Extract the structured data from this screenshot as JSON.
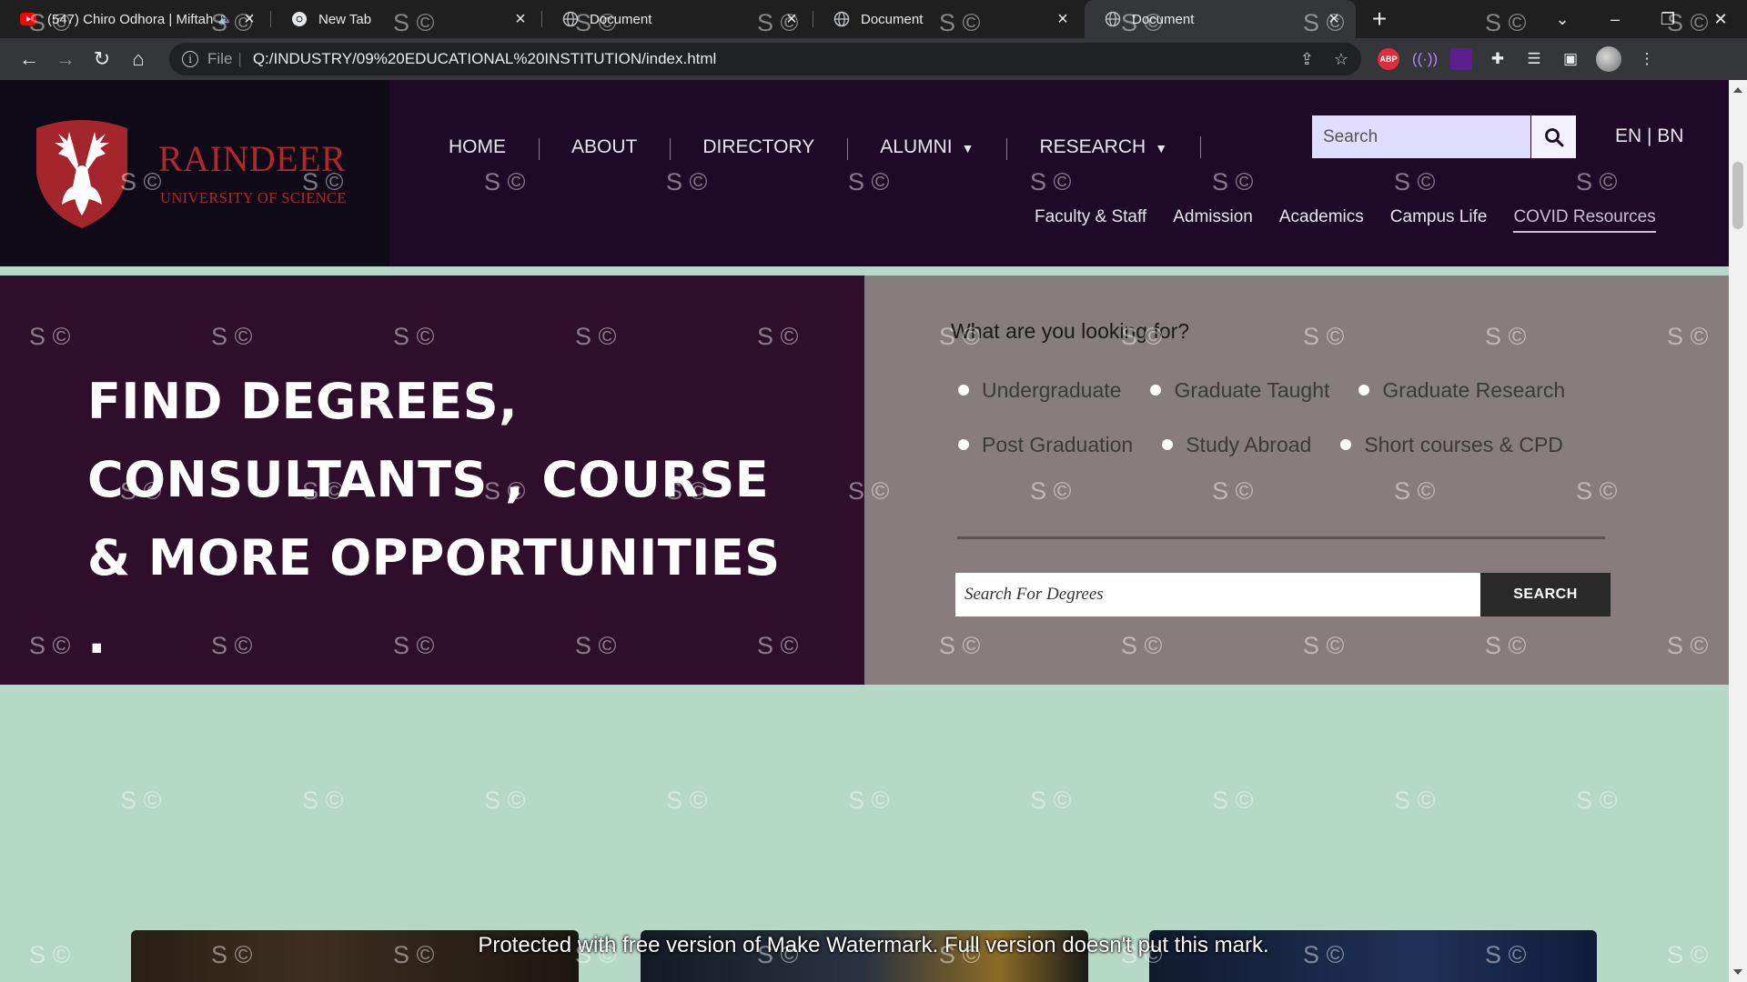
{
  "browser": {
    "tabs": [
      {
        "title": "(547) Chiro Odhora | Miftah",
        "icon": "youtube-icon",
        "audio": true,
        "active": false
      },
      {
        "title": "New Tab",
        "icon": "chrome-icon",
        "audio": false,
        "active": false
      },
      {
        "title": "Document",
        "icon": "globe-icon",
        "audio": false,
        "active": false
      },
      {
        "title": "Document",
        "icon": "globe-icon",
        "audio": false,
        "active": false
      },
      {
        "title": "Document",
        "icon": "globe-icon",
        "audio": false,
        "active": true
      }
    ],
    "address": {
      "scheme": "File",
      "url": "Q:/INDUSTRY/09%20EDUCATIONAL%20INSTITUTION/index.html"
    },
    "colors": {
      "tabbar": "#1f1f1f",
      "toolbar": "#35363a",
      "omnibox": "#202124"
    }
  },
  "site": {
    "logo": {
      "name": "RAINDEER",
      "subtitle": "UNIVERSITY OF SCIENCE",
      "color": "#b0272e"
    },
    "nav": {
      "home": "HOME",
      "about": "ABOUT",
      "directory": "DIRECTORY",
      "alumni": "ALUMNI",
      "research": "RESEARCH"
    },
    "search": {
      "placeholder": "Search"
    },
    "lang": "EN | BN",
    "subnav": {
      "faculty": "Faculty & Staff",
      "admission": "Admission",
      "academics": "Academics",
      "campus": "Campus Life",
      "covid": "COVID Resources"
    },
    "hero": {
      "line1": "FIND DEGREES,",
      "line2": "CONSULTANTS , COURSE",
      "line3": "& MORE OPPORTUNITIES ."
    },
    "finder": {
      "question": "What are you looking for?",
      "options_row1": [
        "Undergraduate",
        "Graduate Taught",
        "Graduate Research"
      ],
      "options_row2": [
        "Post Graduation",
        "Study Abroad",
        "Short courses & CPD"
      ],
      "search_placeholder": "Search For Degrees",
      "search_button": "SEARCH"
    },
    "colors": {
      "header": "#1e0a26",
      "hero_left": "#2e0e2b",
      "hero_right": "#877d7e",
      "page": "#b5d8c7"
    }
  },
  "watermark": {
    "mark": "S ©",
    "banner": "Protected with free version of Make Watermark. Full version doesn't put this mark."
  }
}
